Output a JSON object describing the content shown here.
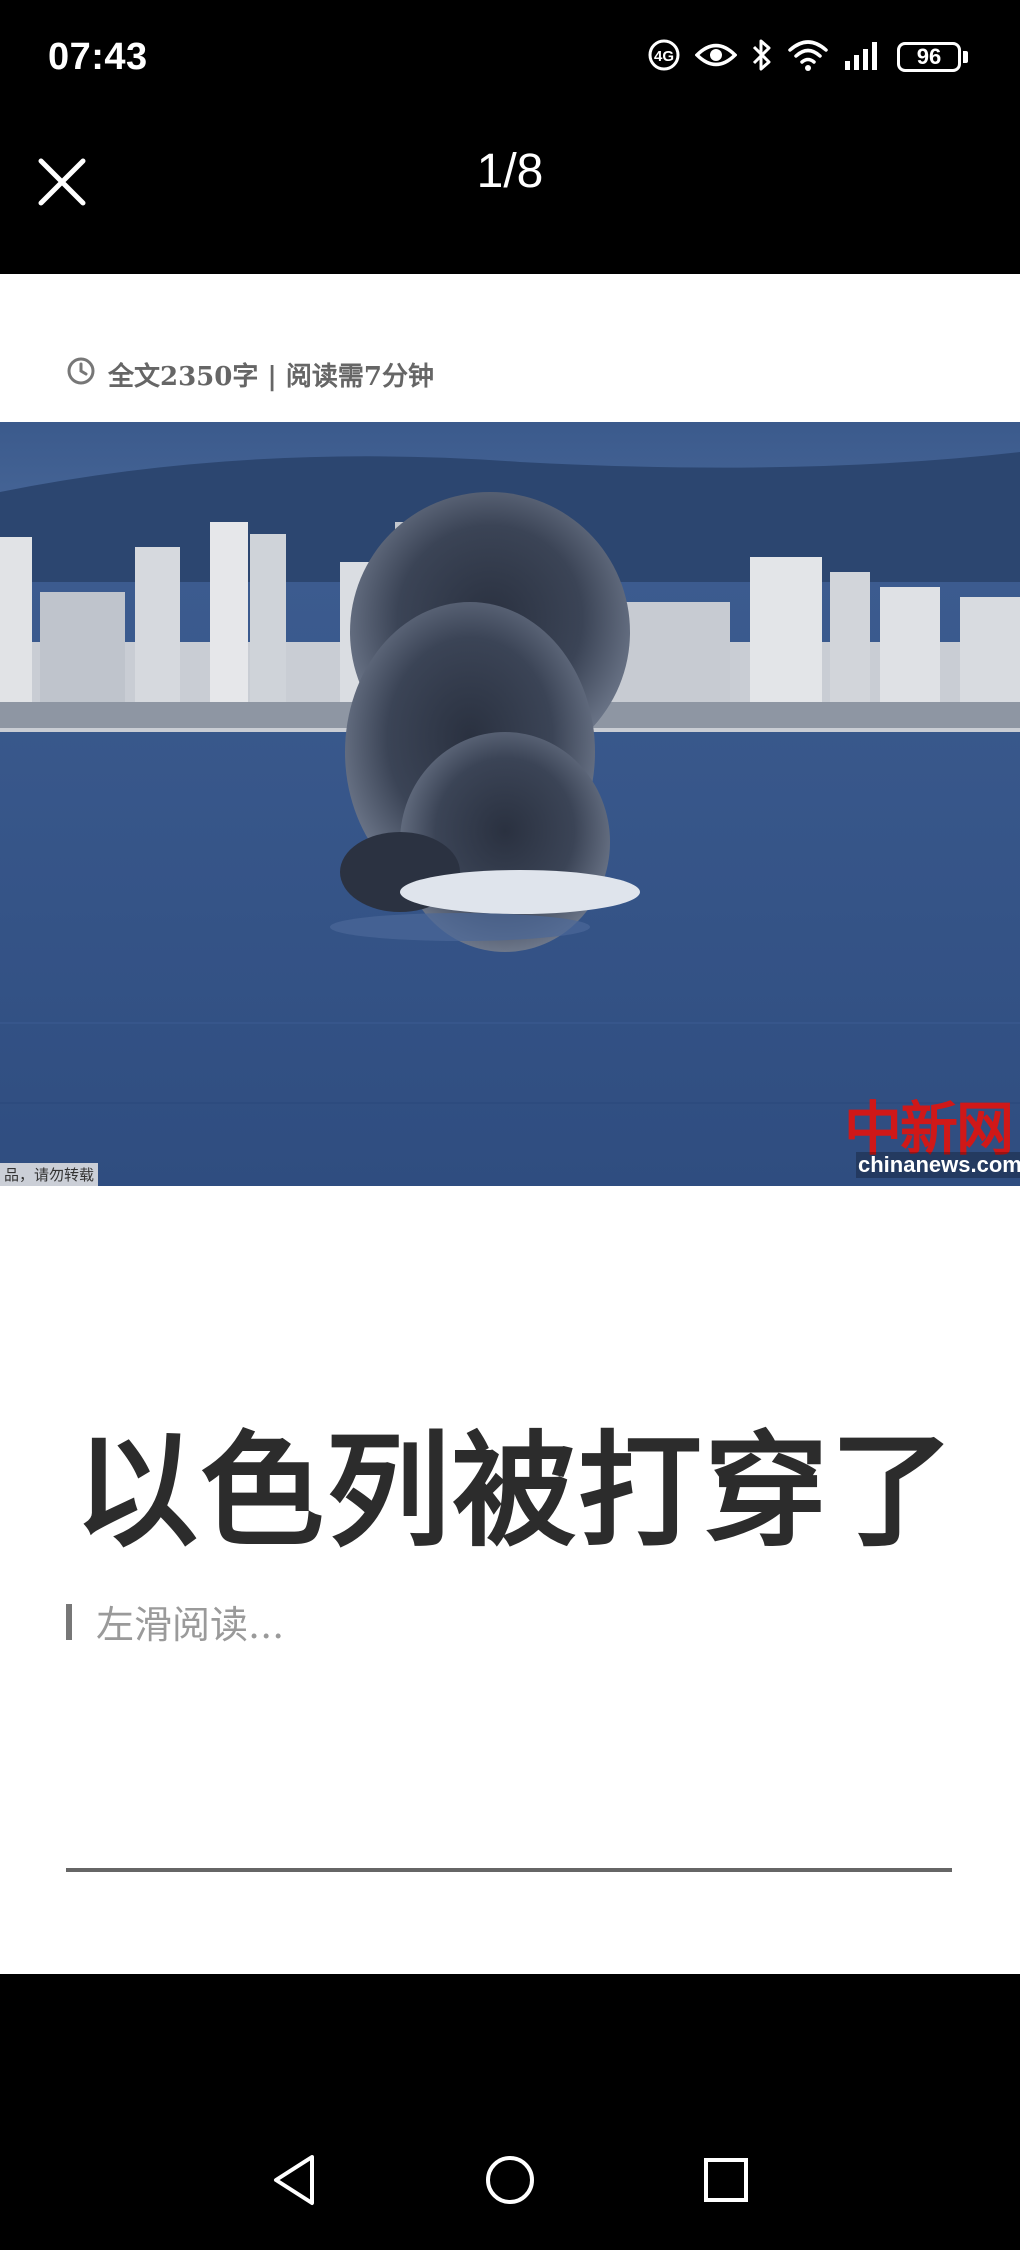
{
  "status_bar": {
    "time": "07:43",
    "battery": "96",
    "icons": [
      "hd-call-icon",
      "eye-comfort-icon",
      "bluetooth-icon",
      "wifi-icon",
      "signal-icon",
      "battery-icon"
    ]
  },
  "header": {
    "page_counter": "1/8",
    "close_icon": "close-icon"
  },
  "article": {
    "meta": "全文2350字 | 阅读需7分钟",
    "meta_icon": "clock-icon",
    "photo": {
      "watermark_logo": "中新网",
      "watermark_url": "chinanews.com.cn",
      "credit": "品，请勿转载"
    },
    "headline": "以色列被打穿了",
    "swipe_hint": "左滑阅读..."
  },
  "navbar": {
    "icons": [
      "back-icon",
      "home-icon",
      "recents-icon"
    ]
  },
  "colors": {
    "background": "#000000",
    "page": "#ffffff",
    "headline": "#2c2c2c",
    "watermark": "#d01818"
  }
}
